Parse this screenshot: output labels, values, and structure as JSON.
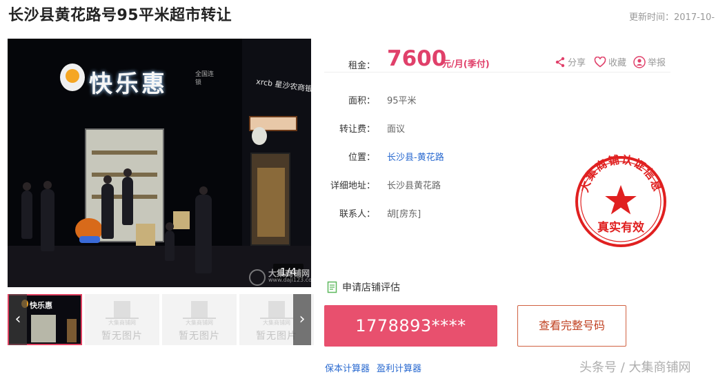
{
  "page": {
    "title": "长沙县黄花路号95平米超市转让",
    "update_time": "更新时间：2017-10-"
  },
  "gallery": {
    "main_photo_alt": "shop front at night",
    "counter": "1/4",
    "watermark_brand": "大集商铺网",
    "watermark_url": "www.daji123.com",
    "sign_text": "快乐惠",
    "sign_small": "全国连锁",
    "bank_sign": "xrcb 星沙农商银行",
    "thumbnails": [
      {
        "type": "photo",
        "label": "快乐惠"
      },
      {
        "type": "placeholder",
        "brand": "大集商铺网",
        "text": "暂无图片"
      },
      {
        "type": "placeholder",
        "brand": "大集商铺网",
        "text": "暂无图片"
      },
      {
        "type": "placeholder",
        "brand": "大集商铺网",
        "text": "暂无图片"
      }
    ],
    "prev_arrow": "‹",
    "next_arrow": "›"
  },
  "listing": {
    "rent_label": "租金：",
    "rent_amount": "7600",
    "rent_unit": "元/月(季付)",
    "share_label": "分享",
    "favorite_label": "收藏",
    "report_label": "举报",
    "rows": [
      {
        "label": "面积：",
        "value": "95平米",
        "link": false
      },
      {
        "label": "转让费：",
        "value": "面议",
        "link": false
      },
      {
        "label": "位置：",
        "value": "长沙县-黄花路",
        "link": true
      },
      {
        "label": "详细地址：",
        "value": "长沙县黄花路",
        "link": false
      },
      {
        "label": "联系人：",
        "value": "胡[房东]",
        "link": false
      }
    ],
    "assess_label": "申请店铺评估",
    "phone_masked": "1778893****",
    "full_number_label": "查看完整号码",
    "calc_links": [
      "保本计算器",
      "盈利计算器"
    ]
  },
  "stamp": {
    "arc_text": "大集商铺认证信息",
    "bottom_text": "真实有效",
    "color": "#e02020"
  },
  "footer": {
    "watermark": "头条号 / 大集商铺网"
  },
  "colors": {
    "accent": "#e0406a",
    "phone_button": "#e8506e",
    "link": "#2a6ad0"
  }
}
